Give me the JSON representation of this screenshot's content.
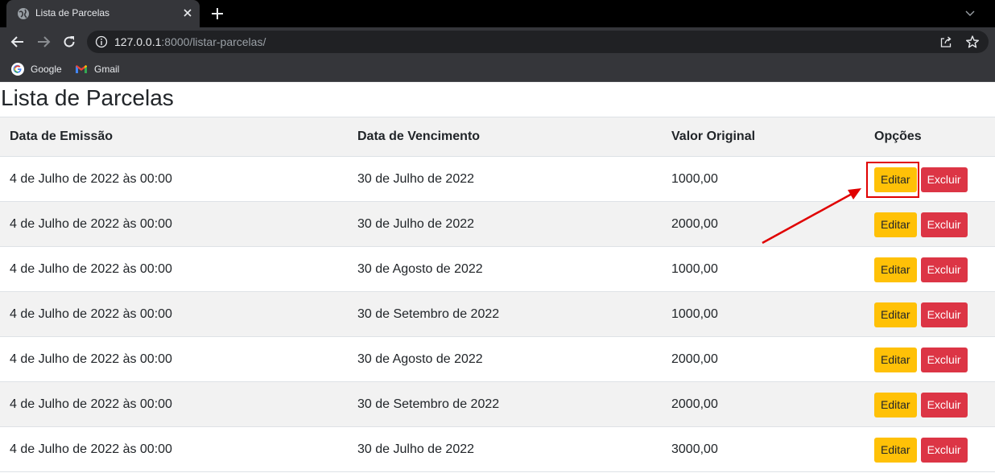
{
  "browser": {
    "tab_title": "Lista de Parcelas",
    "url_host": "127.0.0.1",
    "url_rest": ":8000/listar-parcelas/",
    "bookmarks": [
      {
        "label": "Google",
        "icon": "google-icon"
      },
      {
        "label": "Gmail",
        "icon": "gmail-icon"
      }
    ]
  },
  "page": {
    "title": "Lista de Parcelas",
    "columns": [
      "Data de Emissão",
      "Data de Vencimento",
      "Valor Original",
      "Opções"
    ],
    "rows": [
      {
        "emissao": "4 de Julho de 2022 às 00:00",
        "vencimento": "30 de Julho de 2022",
        "valor": "1000,00"
      },
      {
        "emissao": "4 de Julho de 2022 às 00:00",
        "vencimento": "30 de Julho de 2022",
        "valor": "2000,00"
      },
      {
        "emissao": "4 de Julho de 2022 às 00:00",
        "vencimento": "30 de Agosto de 2022",
        "valor": "1000,00"
      },
      {
        "emissao": "4 de Julho de 2022 às 00:00",
        "vencimento": "30 de Setembro de 2022",
        "valor": "1000,00"
      },
      {
        "emissao": "4 de Julho de 2022 às 00:00",
        "vencimento": "30 de Agosto de 2022",
        "valor": "2000,00"
      },
      {
        "emissao": "4 de Julho de 2022 às 00:00",
        "vencimento": "30 de Setembro de 2022",
        "valor": "2000,00"
      },
      {
        "emissao": "4 de Julho de 2022 às 00:00",
        "vencimento": "30 de Julho de 2022",
        "valor": "3000,00"
      }
    ],
    "edit_label": "Editar",
    "delete_label": "Excluir"
  },
  "colors": {
    "edit_button": "#ffc107",
    "delete_button": "#dc3545",
    "annotation": "#e00000"
  }
}
